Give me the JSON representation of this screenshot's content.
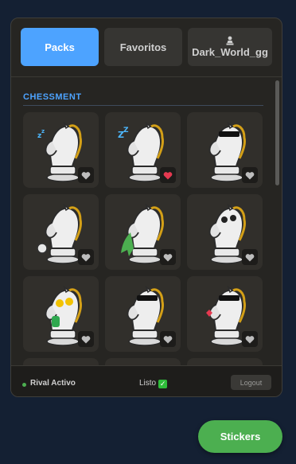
{
  "tabs": [
    {
      "label": "Packs",
      "active": true
    },
    {
      "label": "Favoritos",
      "active": false
    },
    {
      "label": "Dark_World_gg",
      "active": false,
      "icon": "pawn-icon"
    }
  ],
  "section": {
    "title": "CHESSMENT"
  },
  "stickers": [
    {
      "name": "knight-sleepy-yawn",
      "favorite": false
    },
    {
      "name": "knight-sleeping-zzz",
      "favorite": true
    },
    {
      "name": "knight-sunglasses-grimace",
      "favorite": false
    },
    {
      "name": "knight-thumbs-up",
      "favorite": false
    },
    {
      "name": "knight-vomiting",
      "favorite": false
    },
    {
      "name": "knight-dizzy-tongue",
      "favorite": false
    },
    {
      "name": "knight-money-eyes",
      "favorite": false
    },
    {
      "name": "knight-laughing-tears",
      "favorite": false
    },
    {
      "name": "knight-kiss-heart",
      "favorite": false
    }
  ],
  "footer": {
    "status": "Rival Activo",
    "ready": "Listo",
    "ready_icon": "check-icon",
    "logout": "Logout"
  },
  "fab": {
    "label": "Stickers"
  },
  "colors": {
    "accent": "#4da3ff",
    "success": "#4caf50",
    "favorite": "#e53950",
    "heart_inactive": "#bdbdbd"
  }
}
